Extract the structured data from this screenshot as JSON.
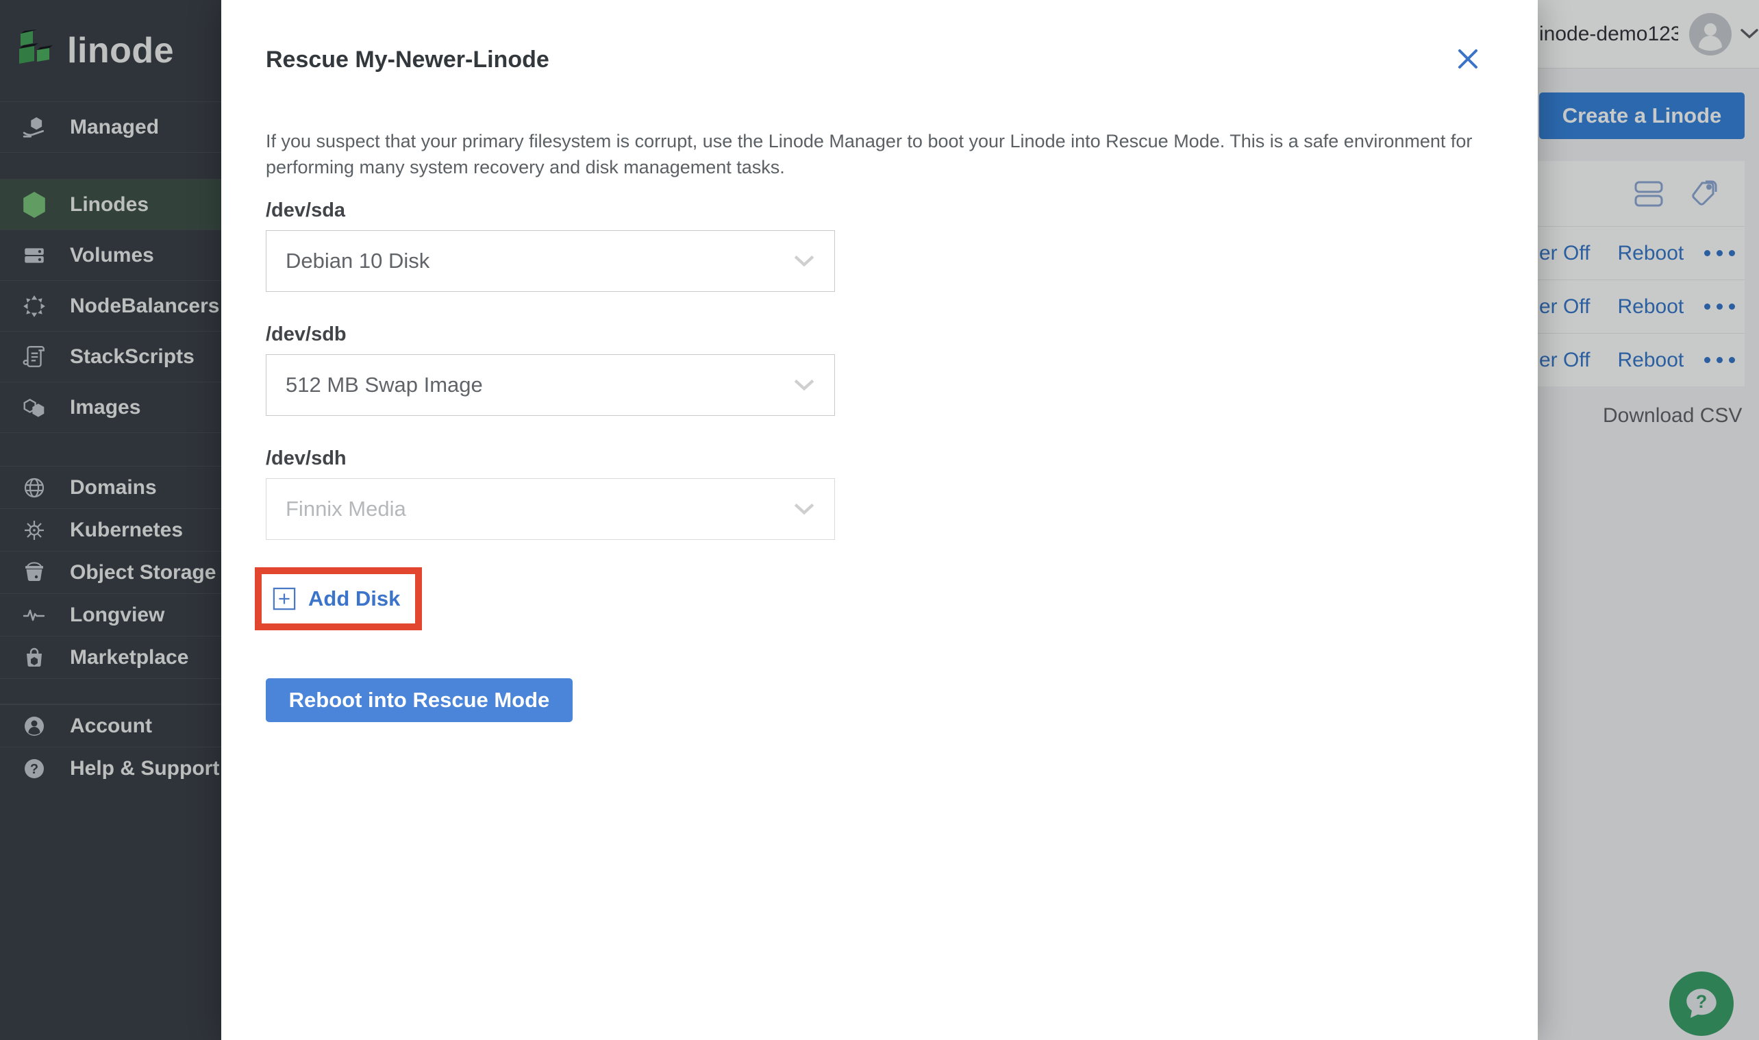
{
  "sidebar": {
    "logo_text": "linode",
    "primary_items": [
      {
        "label": "Managed"
      }
    ],
    "compute_items": [
      {
        "label": "Linodes",
        "selected": true
      },
      {
        "label": "Volumes"
      },
      {
        "label": "NodeBalancers"
      },
      {
        "label": "StackScripts"
      },
      {
        "label": "Images"
      }
    ],
    "services_items": [
      {
        "label": "Domains"
      },
      {
        "label": "Kubernetes"
      },
      {
        "label": "Object Storage"
      },
      {
        "label": "Longview"
      },
      {
        "label": "Marketplace"
      }
    ],
    "account_items": [
      {
        "label": "Account"
      },
      {
        "label": "Help & Support"
      }
    ],
    "help_glyph": "?"
  },
  "modal": {
    "title": "Rescue My-Newer-Linode",
    "description": "If you suspect that your primary filesystem is corrupt, use the Linode Manager to boot your Linode into Rescue Mode. This is a safe environment for performing many system recovery and disk management tasks.",
    "fields": [
      {
        "label": "/dev/sda",
        "value": "Debian 10 Disk"
      },
      {
        "label": "/dev/sdb",
        "value": "512 MB Swap Image"
      },
      {
        "label": "/dev/sdh",
        "value": "Finnix Media",
        "disabled": true
      }
    ],
    "add_disk_label": "Add Disk",
    "submit_label": "Reboot into Rescue Mode"
  },
  "background_page": {
    "username": "inode-demo123",
    "create_button_label": "Create a Linode",
    "action_rows": [
      {
        "power_label": "er Off",
        "reboot_label": "Reboot"
      },
      {
        "power_label": "er Off",
        "reboot_label": "Reboot"
      },
      {
        "power_label": "er Off",
        "reboot_label": "Reboot"
      }
    ],
    "download_csv_label": "Download CSV",
    "help_glyph": "?"
  },
  "colors": {
    "accent_blue": "#3683dc",
    "linode_green": "#7bc77b",
    "annotation_red": "#e2462e",
    "sidebar_bg": "#3b4048",
    "help_green": "#3ba069"
  }
}
